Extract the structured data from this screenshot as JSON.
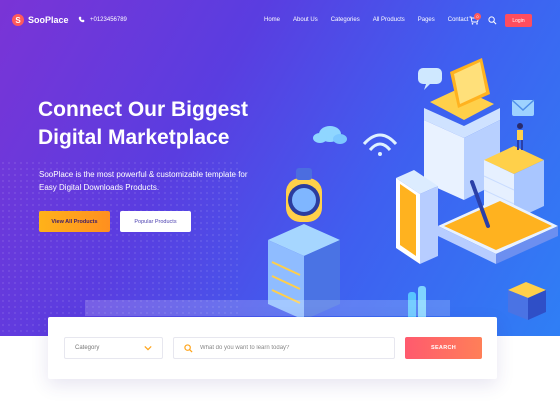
{
  "header": {
    "logo": "SooPlace",
    "phone": "+0123456789",
    "nav": [
      "Home",
      "About Us",
      "Categories",
      "All Products",
      "Pages",
      "Contact"
    ],
    "cart_count": "0",
    "login_label": "Login"
  },
  "hero": {
    "title_line1": "Connect Our Biggest",
    "title_line2": "Digital Marketplace",
    "subtitle_line1": "SooPlace is the most powerful & customizable template for",
    "subtitle_line2": "Easy Digital Downloads Products.",
    "primary_button": "View All Products",
    "secondary_button": "Popular Products"
  },
  "search": {
    "category_value": "Category",
    "placeholder": "What do you want to learn today?",
    "button_label": "SEARCH"
  },
  "colors": {
    "accent_orange": "#ffa51c",
    "accent_red": "#ff4d5e",
    "hero_start": "#7a34d6",
    "hero_end": "#2f7ff5"
  }
}
